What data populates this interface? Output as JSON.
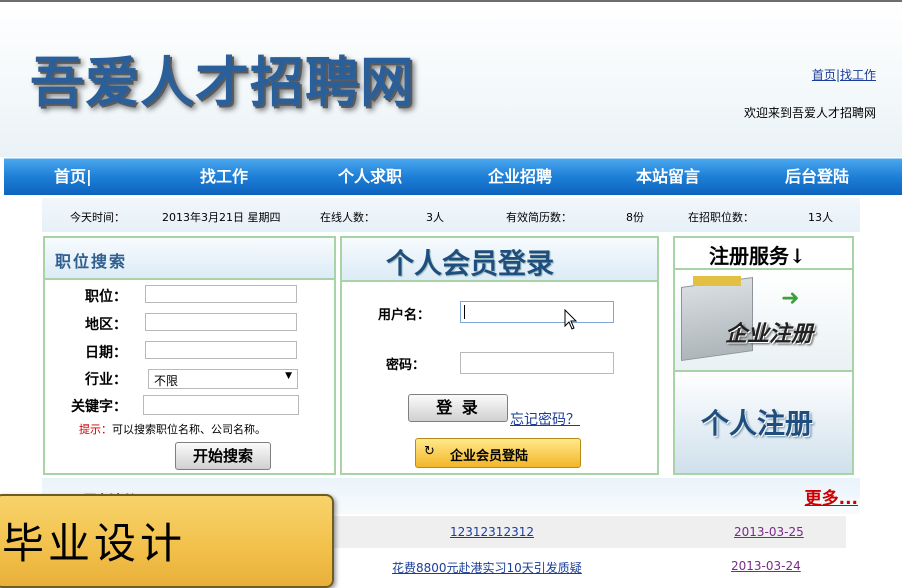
{
  "header": {
    "logo_text": "吾爱人才招聘网",
    "link_home": "首页",
    "link_sep": "|",
    "link_jobs": "找工作",
    "welcome": "欢迎来到吾爱人才招聘网"
  },
  "nav": {
    "items": [
      "首页|",
      "找工作",
      "个人求职",
      "企业招聘",
      "本站留言",
      "后台登陆"
    ]
  },
  "stats": {
    "today_label": "今天时间：",
    "today_value": "2013年3月21日 星期四",
    "online_label": "在线人数：",
    "online_value": "3人",
    "resumes_label": "有效简历数：",
    "resumes_value": "8份",
    "jobs_label": "在招职位数：",
    "jobs_value": "13人"
  },
  "job_search": {
    "title": "职位搜索",
    "position_label": "职位：",
    "region_label": "地区：",
    "date_label": "日期：",
    "industry_label": "行业：",
    "industry_selected": "不限",
    "keyword_label": "关键字：",
    "hint_prefix": "提示：",
    "hint_text": "可以搜索职位名称、公司名称。",
    "search_button": "开始搜索"
  },
  "login": {
    "title": "个人会员登录",
    "username_label": "用户名：",
    "password_label": "密码：",
    "login_button": "登 录",
    "forgot_link": "忘记密码？",
    "enterprise_button": "企业会员登陆"
  },
  "register": {
    "title": "注册服务↓",
    "company_label": "企业注册",
    "personal_label": "个人注册"
  },
  "news": {
    "title": "最新新闻",
    "more": "更多...",
    "items": [
      {
        "title": "12312312312",
        "date": "2013-03-25"
      },
      {
        "title": "花费8800元赴港实习10天引发质疑",
        "date": "2013-03-24"
      }
    ]
  },
  "overlay": {
    "text": "毕业设计"
  },
  "colors": {
    "nav_blue": "#1d7fd6",
    "panel_border": "#a7d3a7",
    "logo_blue": "#2b5f9a",
    "more_red": "#cc0000"
  }
}
